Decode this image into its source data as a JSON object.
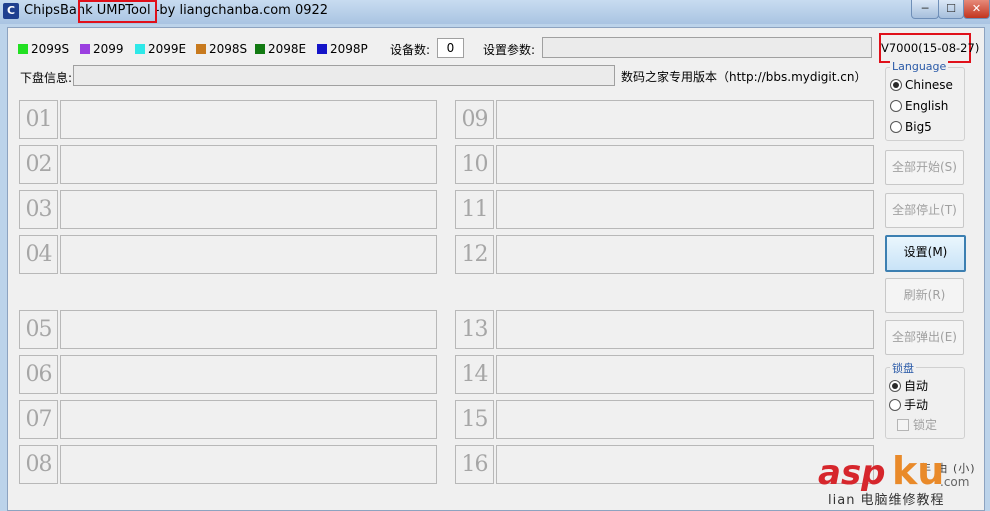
{
  "window": {
    "title": "ChipsBank UMPTool -by liangchanba.com 0922",
    "controls": {
      "minimize": "─",
      "maximize": "☐",
      "close": "✕"
    }
  },
  "legend": [
    {
      "label": "2099S",
      "color": "#22e022"
    },
    {
      "label": "2099",
      "color": "#9b3fe0"
    },
    {
      "label": "2099E",
      "color": "#2ee8e8"
    },
    {
      "label": "2098S",
      "color": "#c87a1e"
    },
    {
      "label": "2098E",
      "color": "#127a12"
    },
    {
      "label": "2098P",
      "color": "#1414c8"
    }
  ],
  "device_count": {
    "label": "设备数:",
    "value": "0"
  },
  "settings_params": {
    "label": "设置参数:",
    "value": ""
  },
  "version": "V7000(15-08-27)",
  "download_info": {
    "label": "下盘信息:",
    "value": ""
  },
  "edition_note": "数码之家专用版本（http://bbs.mydigit.cn）",
  "slots": [
    "01",
    "02",
    "03",
    "04",
    "05",
    "06",
    "07",
    "08",
    "09",
    "10",
    "11",
    "12",
    "13",
    "14",
    "15",
    "16"
  ],
  "language": {
    "title": "Language",
    "options": [
      {
        "label": "Chinese",
        "selected": true
      },
      {
        "label": "English",
        "selected": false
      },
      {
        "label": "Big5",
        "selected": false
      }
    ]
  },
  "buttons": {
    "start_all": "全部开始(S)",
    "stop_all": "全部停止(T)",
    "settings": "设置(M)",
    "refresh": "刷新(R)",
    "eject_all": "全部弹出(E)"
  },
  "lock": {
    "title": "锁盘",
    "options": [
      {
        "label": "自动",
        "selected": true
      },
      {
        "label": "手动",
        "selected": false
      }
    ],
    "lock_checkbox": "锁定"
  },
  "partial_text": "年 由 (小)",
  "watermark": {
    "main": "asp",
    "ku": "ku",
    "com": ".com",
    "sub": "lian  电脑维修教程"
  }
}
